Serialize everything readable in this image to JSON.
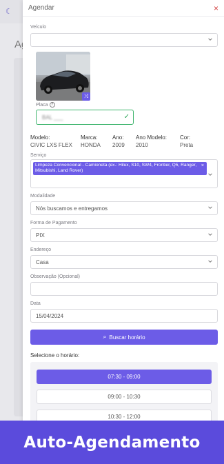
{
  "modal": {
    "title": "Agendar",
    "close_label": "×"
  },
  "background": {
    "title_partial": "Ag"
  },
  "form": {
    "vehicle": {
      "label": "Veículo",
      "value": ""
    },
    "placa": {
      "label": "Placa",
      "value": "BAL ___"
    },
    "specs": [
      {
        "key": "Modelo:",
        "value": "CIVIC LXS FLEX"
      },
      {
        "key": "Marca:",
        "value": "HONDA"
      },
      {
        "key": "Ano:",
        "value": "2009"
      },
      {
        "key": "Ano Modelo:",
        "value": "2010"
      },
      {
        "key": "Cor:",
        "value": "Preta"
      }
    ],
    "service": {
      "label": "Serviço",
      "selected": "Limpeza Convencional - Camioneta (ex.: Hilux, S10, SW4, Frontier, Q5, Ranger, Mitsubishi, Land Rover)"
    },
    "modalidade": {
      "label": "Modalidade",
      "value": "Nós buscamos e entregamos"
    },
    "pagamento": {
      "label": "Forma de Pagamento",
      "value": "PIX"
    },
    "endereco": {
      "label": "Endereço",
      "value": "Casa"
    },
    "observacao": {
      "label": "Observação (Opcional)",
      "value": ""
    },
    "data": {
      "label": "Data",
      "value": "15/04/2024"
    }
  },
  "search_button": {
    "label": "Buscar horário"
  },
  "time_section": {
    "title": "Selecione o horário:",
    "slots": [
      "07:30 - 09:00",
      "09:00 - 10:30",
      "10:30 - 12:00"
    ],
    "selected_index": 0
  },
  "banner": {
    "text": "Auto-Agendamento"
  },
  "colors": {
    "accent": "#6c5ce7",
    "banner": "#5b4bdc",
    "success": "#2fa85a",
    "close": "#d23c3c"
  }
}
